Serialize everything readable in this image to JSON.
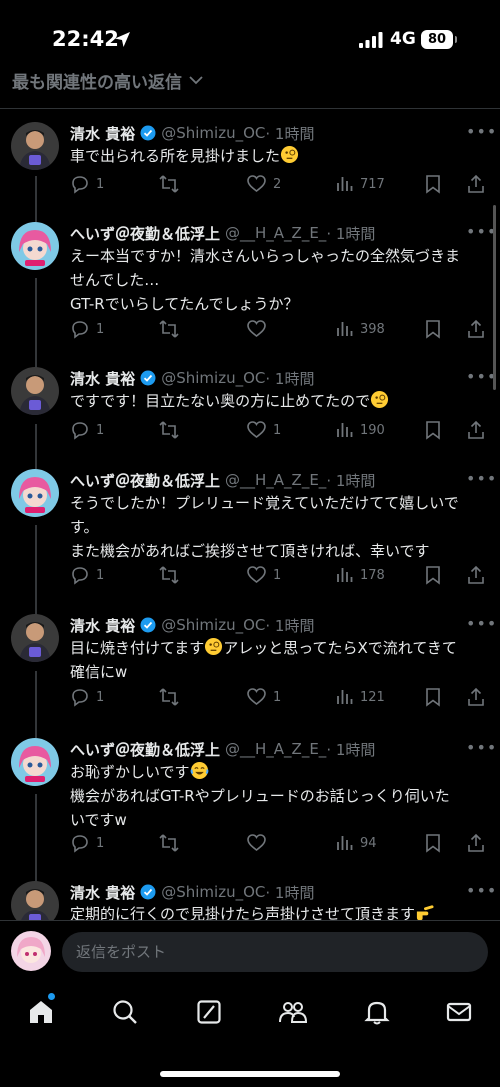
{
  "status_bar": {
    "time": "22:42",
    "network": "4G",
    "battery": "80"
  },
  "header": {
    "sort_label": "最も関連性の高い返信"
  },
  "tweets": [
    {
      "name": "清水 貴裕",
      "verified": true,
      "handle": "@Shimizu_OC",
      "time": "· 1時間",
      "lines": [
        "車で出られる所を見掛けました"
      ],
      "emoji": "monocle",
      "replies": "1",
      "retweets": "",
      "likes": "2",
      "views": "717",
      "avatar": "shimizu"
    },
    {
      "name": "へいず＠夜勤＆低浮上",
      "verified": false,
      "handle": "@__H_A_Z_E_",
      "time": "· 1時間",
      "lines": [
        "えー本当ですか！清水さんいらっしゃったの全然気づきま",
        "せんでした…",
        "GT-Rでいらしてたんでしょうか？"
      ],
      "emoji": "",
      "replies": "1",
      "retweets": "",
      "likes": "",
      "views": "398",
      "avatar": "haze"
    },
    {
      "name": "清水 貴裕",
      "verified": true,
      "handle": "@Shimizu_OC",
      "time": "· 1時間",
      "lines": [
        "ですです！目立たない奥の方に止めてたので"
      ],
      "emoji": "monocle",
      "replies": "1",
      "retweets": "",
      "likes": "1",
      "views": "190",
      "avatar": "shimizu"
    },
    {
      "name": "へいず＠夜勤＆低浮上",
      "verified": false,
      "handle": "@__H_A_Z_E_",
      "time": "· 1時間",
      "lines": [
        "そうでしたか！プレリュード覚えていただけてて嬉しいで",
        "す。",
        "また機会があればご挨拶させて頂きければ、幸いです"
      ],
      "emoji": "",
      "replies": "1",
      "retweets": "",
      "likes": "1",
      "views": "178",
      "avatar": "haze"
    },
    {
      "name": "清水 貴裕",
      "verified": true,
      "handle": "@Shimizu_OC",
      "time": "· 1時間",
      "lines": [
        "目に焼き付けてます",
        "アレッと思ってたらXで流れてきて",
        "確信にw"
      ],
      "emoji": "monocle-inline",
      "replies": "1",
      "retweets": "",
      "likes": "1",
      "views": "121",
      "avatar": "shimizu"
    },
    {
      "name": "へいず＠夜勤＆低浮上",
      "verified": false,
      "handle": "@__H_A_Z_E_",
      "time": "· 1時間",
      "lines": [
        "お恥ずかしいです",
        "機会があればGT-Rやプレリュードのお話じっくり伺いた",
        "いですw"
      ],
      "emoji": "laugh",
      "replies": "1",
      "retweets": "",
      "likes": "",
      "views": "94",
      "avatar": "haze"
    },
    {
      "name": "清水 貴裕",
      "verified": true,
      "handle": "@Shimizu_OC",
      "time": "· 1時間",
      "lines": [
        "定期的に行くので見掛けたら声掛けさせて頂きます"
      ],
      "emoji": "point",
      "replies": "",
      "retweets": "",
      "likes": "",
      "views": "",
      "avatar": "shimizu"
    }
  ],
  "reply_bar": {
    "placeholder": "返信をポスト"
  },
  "tabs": [
    "home-icon",
    "search-icon",
    "grok-icon",
    "communities-icon",
    "notifications-icon",
    "messages-icon"
  ],
  "colors": {
    "accent": "#1d9bf0",
    "muted": "#71767b",
    "text": "#e7e9ea",
    "background": "#000000"
  }
}
